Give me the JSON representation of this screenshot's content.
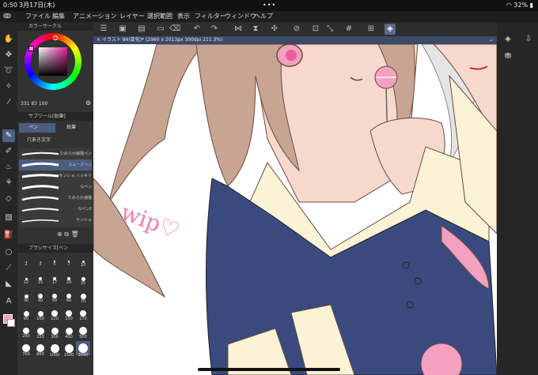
{
  "status": {
    "time": "0:50",
    "date": "3月17日(木)",
    "battery": "32%"
  },
  "menu": {
    "items": [
      "ファイル",
      "編集",
      "アニメーション",
      "レイヤー",
      "選択範囲",
      "表示",
      "フィルター",
      "ウィンドウ",
      "ヘルプ"
    ]
  },
  "panels": {
    "color_wheel_title": "カラーサークル",
    "hsv": "331  83  100",
    "subtool_title": "サブツール[鉛筆]",
    "tab_pen": "ペン",
    "tab_pencil": "鉛筆",
    "tab_blend": "穴あき文字",
    "brushes": [
      "ためらか線描ペン",
      "スムーズペン",
      "サンショ ハッキリ",
      "Gペン",
      "ためらか通描",
      "Gペン2",
      "サンショ",
      "Gペン"
    ],
    "brush_size_title": "ブラシサイズ[ペン",
    "sizes": [
      "2",
      "3",
      "5",
      "7",
      "10",
      "12",
      "15",
      "17",
      "20",
      "25",
      "30",
      "40",
      "50",
      "60",
      "70",
      "80",
      "100",
      "120",
      "150",
      "170",
      "200",
      "250",
      "300",
      "400",
      "500",
      "700",
      "800",
      "1000",
      "1500",
      "2000"
    ]
  },
  "canvas": {
    "title": "× イラスト 84(変化)* (2960 x 2013px 300dpi 211.3%)",
    "wip_text": "wip♡"
  },
  "colors": {
    "accent": "#4e5f82",
    "skin": "#f6d9cc",
    "hair": "#c7a592",
    "dress": "#3b4a7e",
    "collar": "#fbf3d6",
    "pink": "#f4a0c0",
    "wip": "#f27db0"
  }
}
